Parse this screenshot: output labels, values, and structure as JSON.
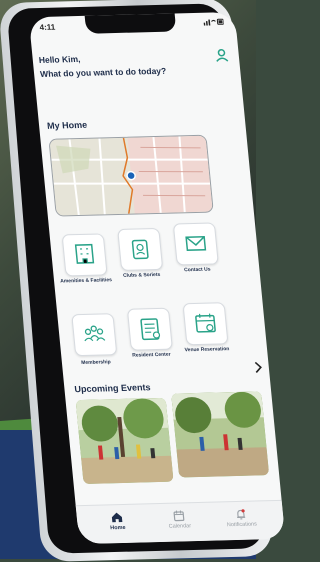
{
  "status": {
    "time": "4:11"
  },
  "header": {
    "greeting": "Hello Kim,",
    "question": "What do you want to do today?"
  },
  "my_home": {
    "title": "My Home"
  },
  "tiles": [
    {
      "label": "Amenities & Facilities"
    },
    {
      "label": "Clubs & Soriets"
    },
    {
      "label": "Contact Us"
    },
    {
      "label": "Membership"
    },
    {
      "label": "Resident Center"
    },
    {
      "label": "Venue Reservation"
    }
  ],
  "events": {
    "title": "Upcoming Events"
  },
  "tabbar": {
    "items": [
      {
        "label": "Home"
      },
      {
        "label": "Calendar"
      },
      {
        "label": "Notifications"
      }
    ]
  },
  "colors": {
    "accent": "#1e2d4a",
    "teal": "#2aa389",
    "map_route": "#e07a2a"
  }
}
